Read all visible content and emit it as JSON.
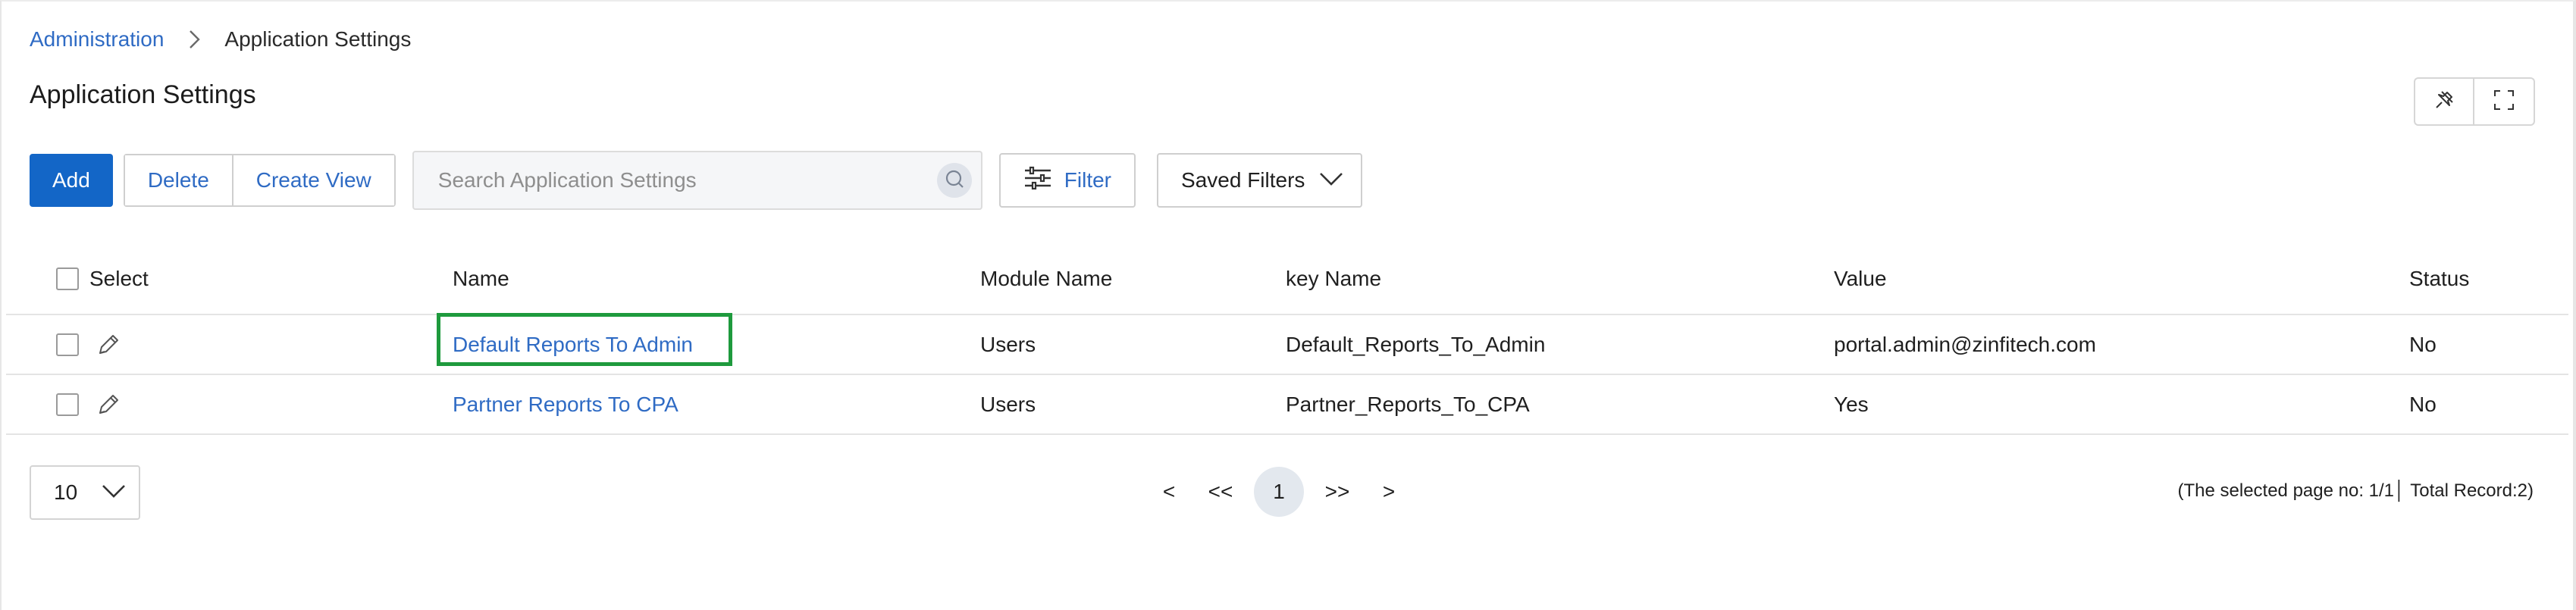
{
  "breadcrumb": {
    "parent": "Administration",
    "current": "Application Settings"
  },
  "page_title": "Application Settings",
  "toolbar": {
    "add_label": "Add",
    "delete_label": "Delete",
    "create_view_label": "Create View",
    "search_placeholder": "Search Application Settings",
    "filter_label": "Filter",
    "saved_filters_label": "Saved Filters"
  },
  "table": {
    "headers": {
      "select": "Select",
      "name": "Name",
      "module": "Module Name",
      "key": "key Name",
      "value": "Value",
      "status": "Status"
    },
    "rows": [
      {
        "name": "Default Reports To Admin",
        "module": "Users",
        "key": "Default_Reports_To_Admin",
        "value": "portal.admin@zinfitech.com",
        "status": "No"
      },
      {
        "name": "Partner Reports To CPA",
        "module": "Users",
        "key": "Partner_Reports_To_CPA",
        "value": "Yes",
        "status": "No"
      }
    ]
  },
  "pagination": {
    "page_size": "10",
    "prev": "<",
    "first": "<<",
    "current": "1",
    "last": ">>",
    "next": ">",
    "record_info": "(The selected page no: 1/1│ Total Record:2)"
  },
  "colors": {
    "accent": "#1366c7",
    "link": "#2f6bc4",
    "highlight": "#1e9a3d"
  },
  "icons": {
    "breadcrumb_sep": "chevron-right-icon",
    "pin": "pin-icon",
    "fullscreen": "fullscreen-icon",
    "search": "search-icon",
    "filter": "sliders-icon",
    "dropdown": "chevron-down-icon",
    "edit": "pencil-icon"
  }
}
